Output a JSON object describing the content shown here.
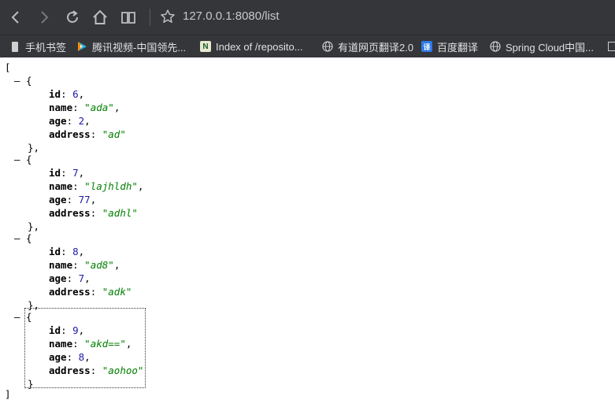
{
  "toolbar": {
    "url": "127.0.0.1:8080/list",
    "back_icon": "chevron-left-icon",
    "forward_icon": "chevron-right-icon",
    "reload_icon": "reload-icon",
    "home_icon": "home-icon",
    "reader_icon": "book-icon",
    "star_icon": "star-icon"
  },
  "bookmarks": [
    {
      "label": "手机书签",
      "icon": "phone-icon"
    },
    {
      "label": "腾讯视频-中国领先...",
      "icon": "tencent-video-icon"
    },
    {
      "label": "Index of /reposito...",
      "icon": "n-logo-icon"
    },
    {
      "label": "有道网页翻译2.0",
      "icon": "globe-icon"
    },
    {
      "label": "百度翻译",
      "icon": "translate-icon"
    },
    {
      "label": "Spring Cloud中国...",
      "icon": "globe-icon"
    }
  ],
  "json_view": {
    "open_bracket": "[",
    "close_bracket": "]",
    "collapse_symbol": "–",
    "items": [
      {
        "id": "6",
        "name": "\"ada\"",
        "age": "2",
        "address": "\"ad\""
      },
      {
        "id": "7",
        "name": "\"lajhldh\"",
        "age": "77",
        "address": "\"adhl\""
      },
      {
        "id": "8",
        "name": "\"ad8\"",
        "age": "7",
        "address": "\"adk\""
      },
      {
        "id": "9",
        "name": "\"akd==\"",
        "age": "8",
        "address": "\"aohoo\""
      }
    ],
    "keys": {
      "id": "id",
      "name": "name",
      "age": "age",
      "address": "address"
    }
  }
}
